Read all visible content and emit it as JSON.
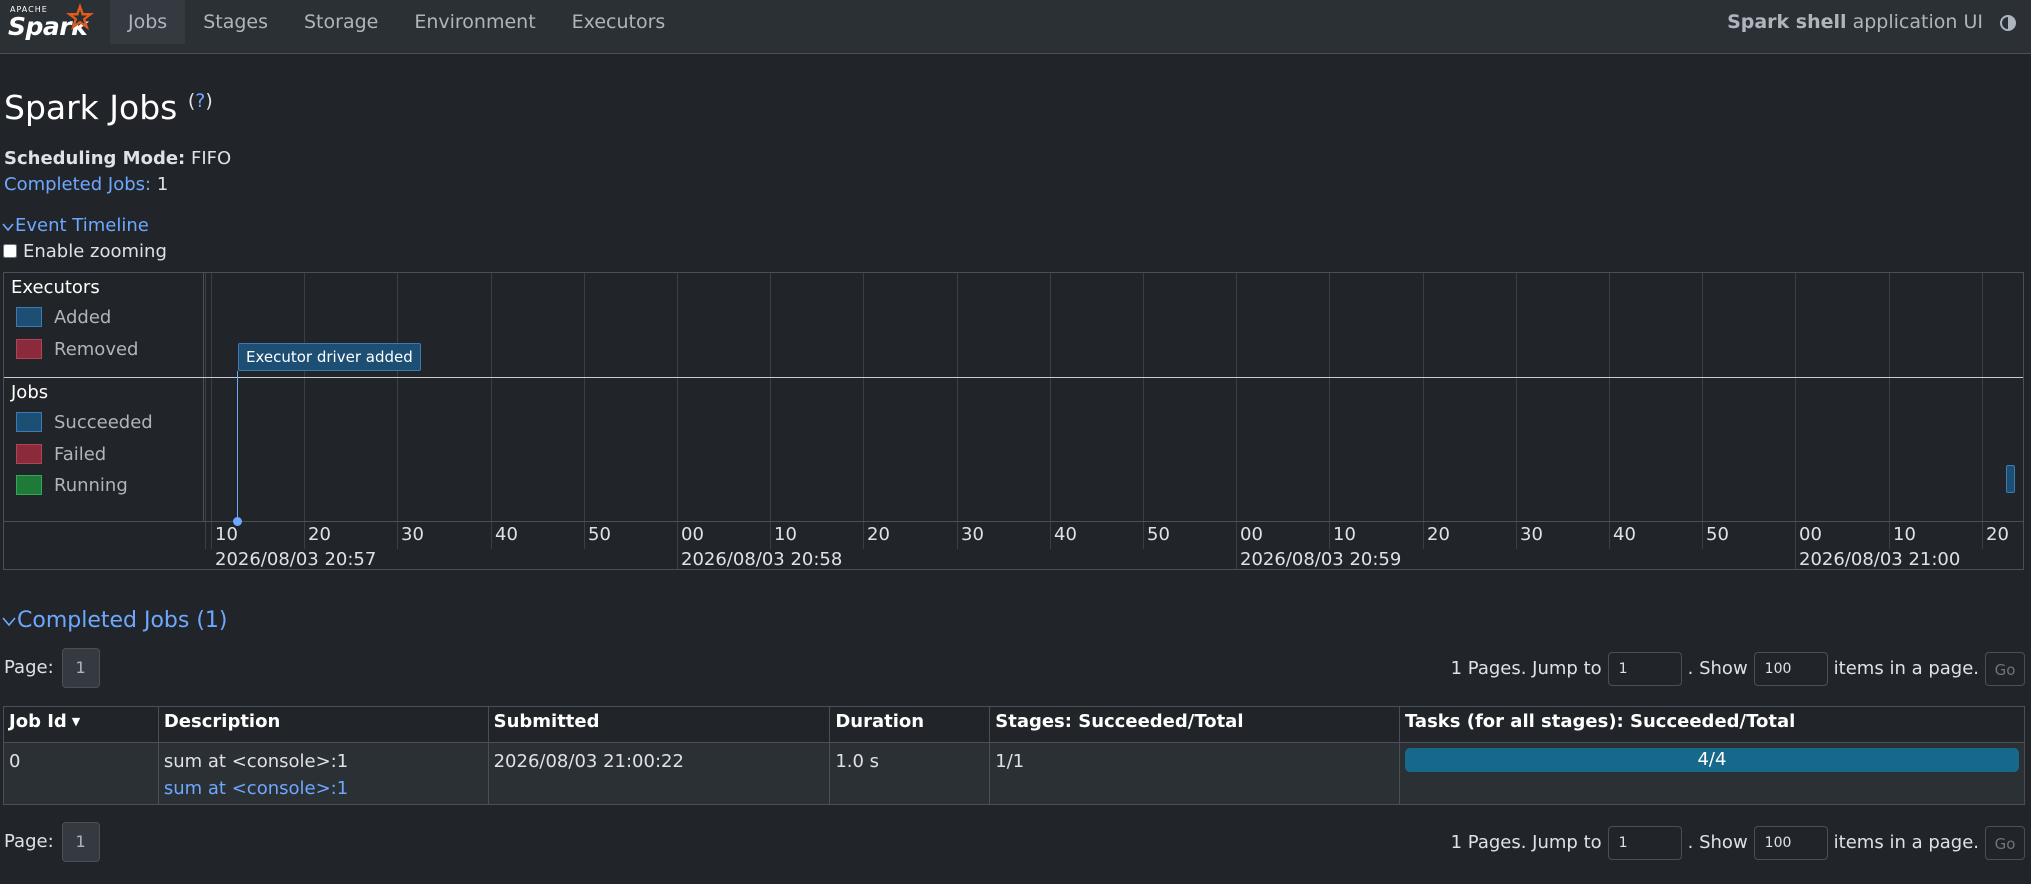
{
  "brand": {
    "apache": "APACHE",
    "name": "Spark"
  },
  "nav": {
    "tabs": [
      {
        "label": "Jobs",
        "active": true
      },
      {
        "label": "Stages",
        "active": false
      },
      {
        "label": "Storage",
        "active": false
      },
      {
        "label": "Environment",
        "active": false
      },
      {
        "label": "Executors",
        "active": false
      }
    ],
    "app_name": "Spark shell",
    "app_suffix": "application UI"
  },
  "page": {
    "title": "Spark Jobs",
    "help": "?",
    "scheduling_mode_label": "Scheduling Mode:",
    "scheduling_mode_value": "FIFO",
    "completed_jobs_label": "Completed Jobs:",
    "completed_jobs_value": "1"
  },
  "timeline": {
    "toggle_label": "Event Timeline",
    "zoom_label": "Enable zooming",
    "executors_title": "Executors",
    "executors_legend": [
      "Added",
      "Removed"
    ],
    "jobs_title": "Jobs",
    "jobs_legend": [
      "Succeeded",
      "Failed",
      "Running"
    ],
    "event_label": "Executor driver added",
    "minor_ticks": [
      "10",
      "20",
      "30",
      "40",
      "50",
      "00",
      "10",
      "20",
      "30",
      "40",
      "50",
      "00",
      "10",
      "20",
      "30",
      "40",
      "50",
      "00",
      "10",
      "20"
    ],
    "major_ticks": [
      "2026/08/03 20:57",
      "2026/08/03 20:58",
      "2026/08/03 20:59",
      "2026/08/03 21:00"
    ]
  },
  "completed": {
    "title": "Completed Jobs (1)",
    "pager": {
      "page_label": "Page:",
      "current_page": "1",
      "pages_text": "1 Pages. Jump to",
      "jump_value": "1",
      "show_text": ". Show",
      "show_value": "100",
      "items_text": "items in a page.",
      "go_label": "Go"
    },
    "columns": [
      "Job Id",
      "Description",
      "Submitted",
      "Duration",
      "Stages: Succeeded/Total",
      "Tasks (for all stages): Succeeded/Total"
    ],
    "rows": [
      {
        "job_id": "0",
        "description": "sum at <console>:1",
        "description_link": "sum at <console>:1",
        "submitted": "2026/08/03 21:00:22",
        "duration": "1.0 s",
        "stages": "1/1",
        "tasks": "4/4",
        "tasks_fraction": 1.0
      }
    ]
  }
}
